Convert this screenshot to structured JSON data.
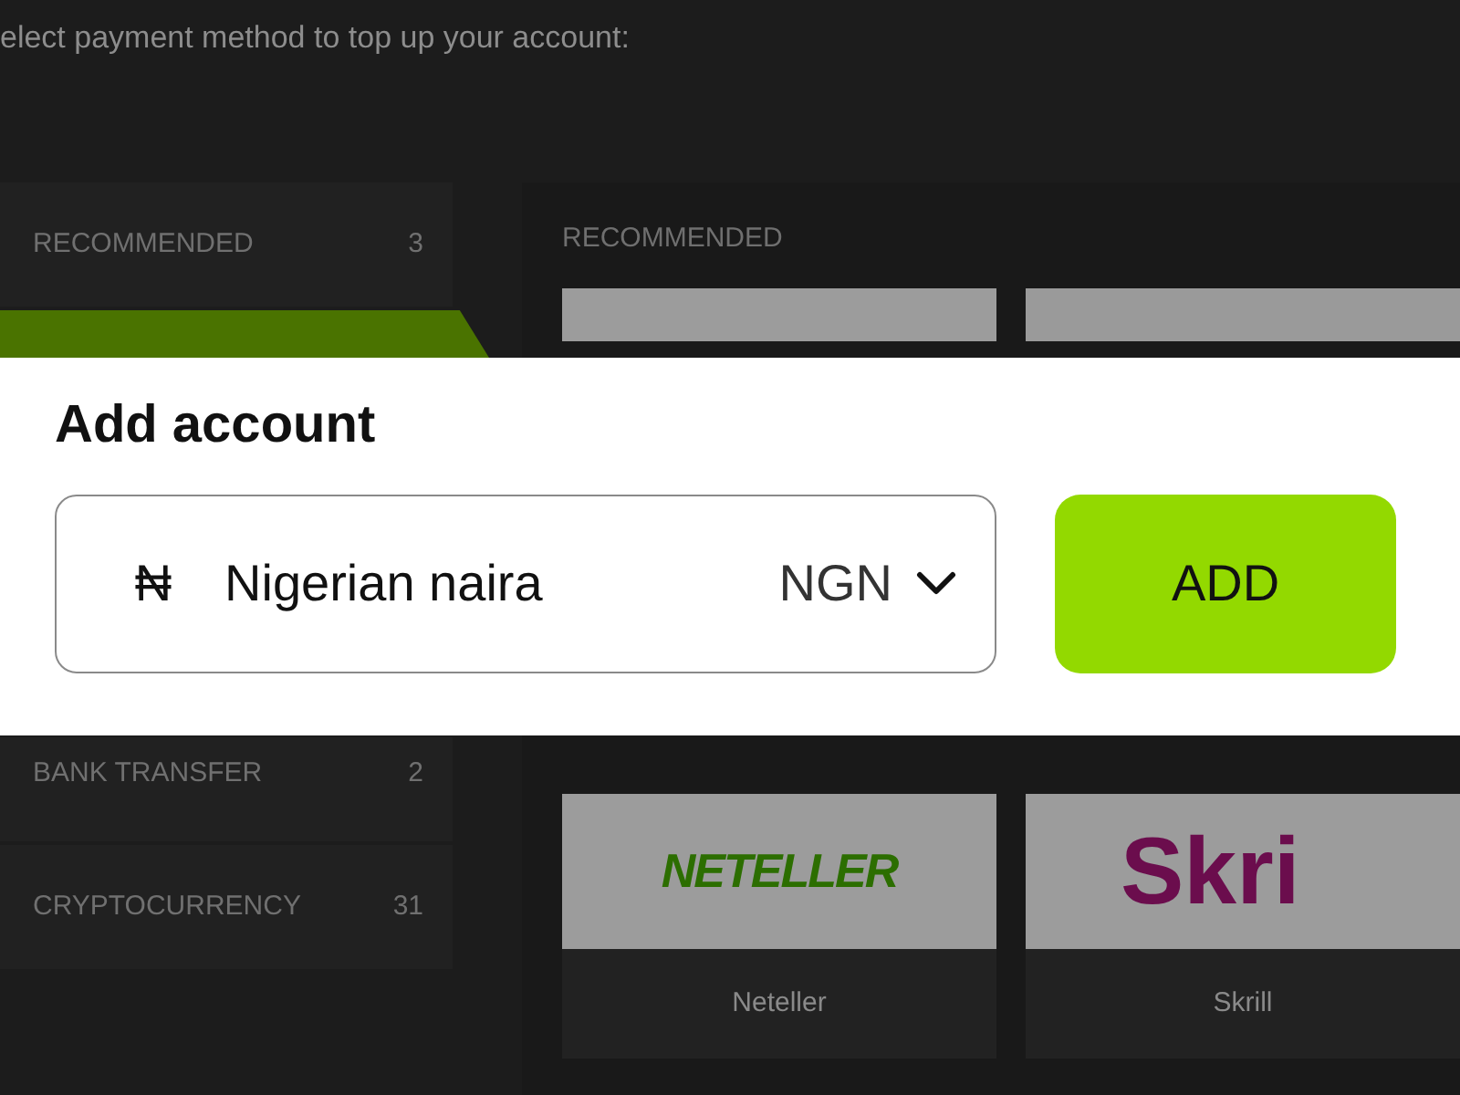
{
  "instruction": "elect payment method to top up your account:",
  "sidebar": {
    "items": [
      {
        "label": "RECOMMENDED",
        "count": "3",
        "selected": false
      },
      {
        "selected": true
      },
      {
        "label": "BANK TRANSFER",
        "count": "2",
        "selected": false
      },
      {
        "label": "CRYPTOCURRENCY",
        "count": "31",
        "selected": false
      }
    ]
  },
  "sections": [
    {
      "heading": "RECOMMENDED",
      "cards": [
        {
          "kind": "plain"
        },
        {
          "kind": "light"
        }
      ]
    },
    {
      "cards": [
        {
          "kind": "neteller",
          "logo": "NETELLER",
          "label": "Neteller"
        },
        {
          "kind": "skrill",
          "logo": "Skri",
          "label": "Skrill"
        }
      ]
    }
  ],
  "modal": {
    "title": "Add account",
    "currency": {
      "symbol": "₦",
      "name": "Nigerian naira",
      "code": "NGN"
    },
    "button": "ADD"
  }
}
